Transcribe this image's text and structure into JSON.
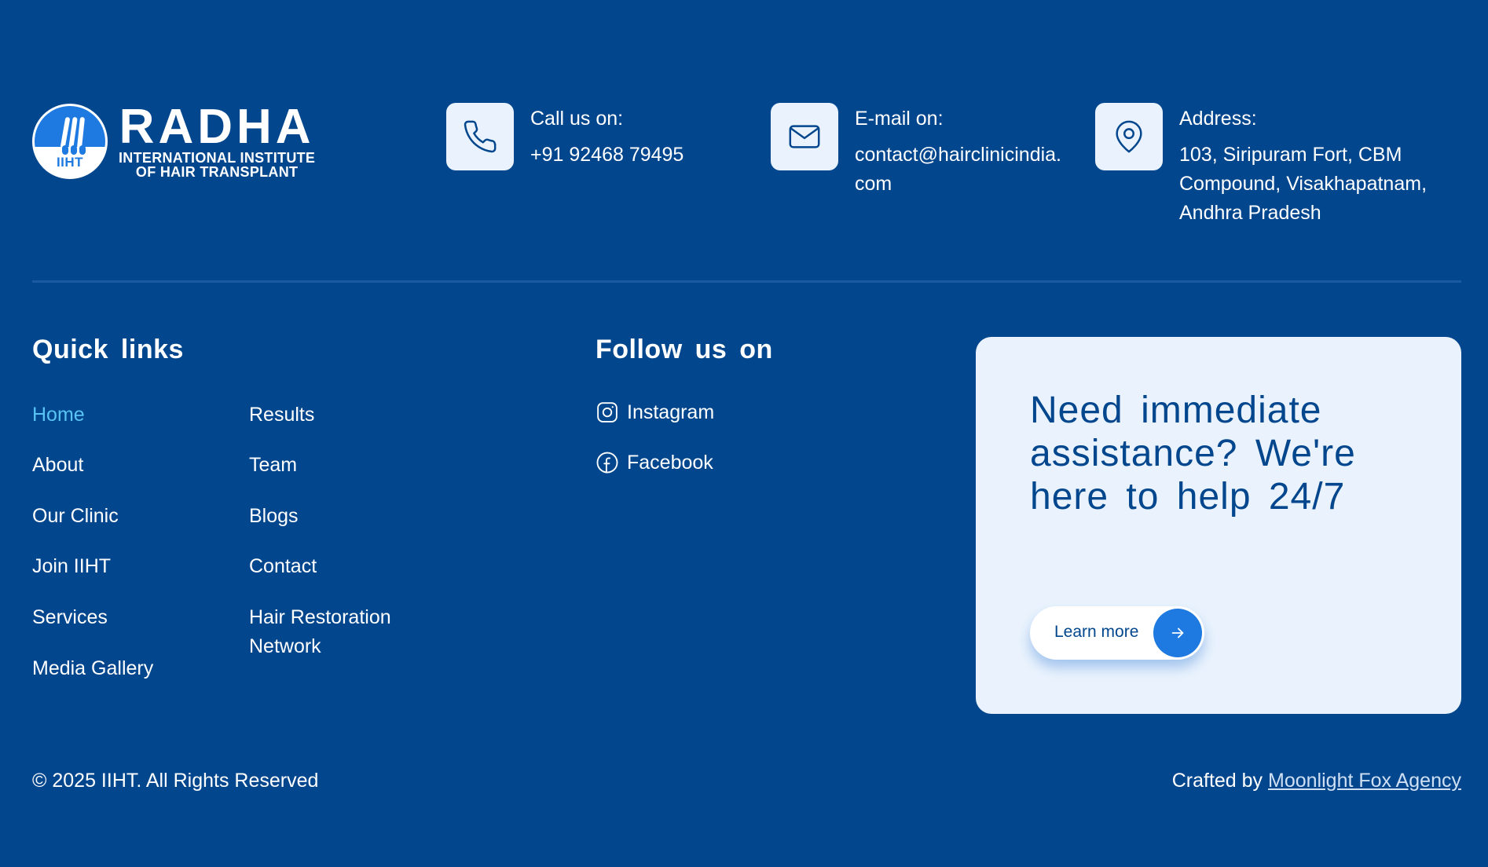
{
  "brand": {
    "name": "RADHA",
    "subtitle_line1": "INTERNATIONAL INSTITUTE",
    "subtitle_line2": "OF HAIR TRANSPLANT",
    "abbr": "IIHT"
  },
  "contacts": {
    "phone": {
      "label": "Call us on:",
      "value": "+91 92468 79495",
      "icon": "phone-icon"
    },
    "email": {
      "label": "E-mail on:",
      "value": "contact@hairclinicindia.com",
      "icon": "mail-icon"
    },
    "address": {
      "label": "Address:",
      "value": "103, Siripuram Fort, CBM Compound, Visakhapatnam, Andhra Pradesh",
      "icon": "location-pin-icon"
    }
  },
  "quick_links": {
    "title": "Quick links",
    "items": [
      {
        "label": "Home",
        "active": true
      },
      {
        "label": "About"
      },
      {
        "label": "Our Clinic"
      },
      {
        "label": "Join IIHT"
      },
      {
        "label": "Services"
      },
      {
        "label": "Media Gallery"
      },
      {
        "label": "Results"
      },
      {
        "label": "Team"
      },
      {
        "label": "Blogs"
      },
      {
        "label": "Contact"
      },
      {
        "label": "Hair Restoration Network"
      }
    ]
  },
  "follow": {
    "title": "Follow us on",
    "items": [
      {
        "label": "Instagram",
        "icon": "instagram-icon"
      },
      {
        "label": "Facebook",
        "icon": "facebook-icon"
      }
    ]
  },
  "cta": {
    "title": "Need immediate assistance? We're here to help 24/7",
    "button_label": "Learn more"
  },
  "footer": {
    "copyright": "© 2025 IIHT. All Rights Reserved",
    "credit_prefix": "Crafted by",
    "credit_link": "Moonlight Fox Agency"
  },
  "colors": {
    "background": "#02468d",
    "accent": "#1e7ae0",
    "active_link": "#59c3f5",
    "card": "#eaf3fd"
  }
}
